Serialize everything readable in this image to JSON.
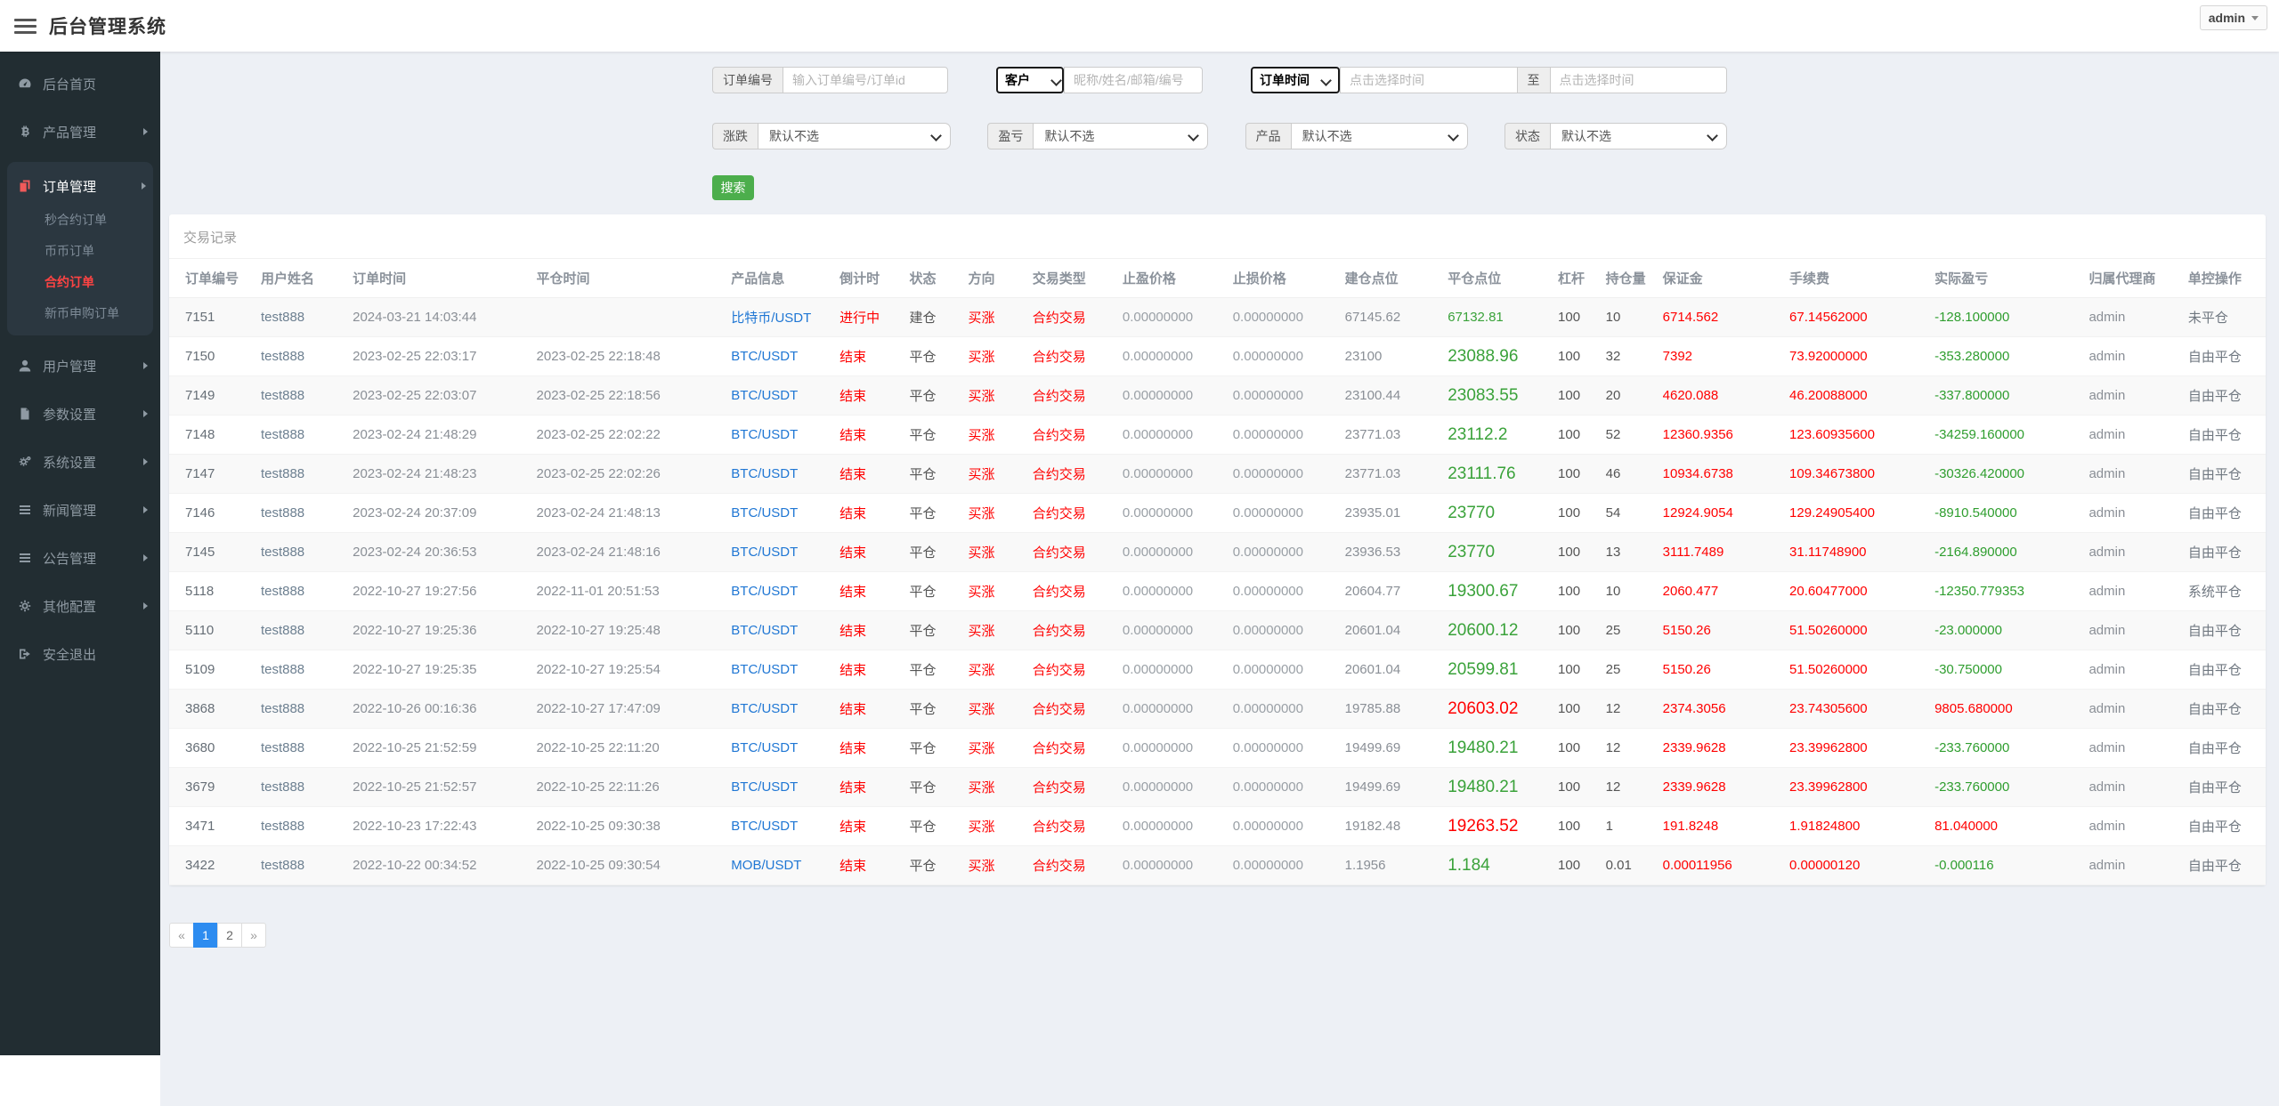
{
  "header": {
    "title": "后台管理系统",
    "user": "admin"
  },
  "colors": {
    "sidebar_bg": "#222d32",
    "main_bg": "#edf0f5",
    "red": "#ff0000",
    "green_close": "#3aa23a",
    "green_pl": "#2f9e2f",
    "link_blue": "#2077d4",
    "search_green": "#4cae4c",
    "active_menu_red": "#ff4343",
    "pagination_blue": "#2d8cf0"
  },
  "sidebar": {
    "items": [
      {
        "key": "home",
        "label": "后台首页",
        "icon": "dashboard-icon",
        "arrow": false
      },
      {
        "key": "products",
        "label": "产品管理",
        "icon": "bitcoin-icon",
        "arrow": true
      },
      {
        "key": "orders",
        "label": "订单管理",
        "icon": "orders-icon",
        "arrow": true,
        "active": true,
        "children": [
          {
            "key": "second-contract",
            "label": "秒合约订单",
            "active": false
          },
          {
            "key": "coin",
            "label": "币币订单",
            "active": false
          },
          {
            "key": "contract",
            "label": "合约订单",
            "active": true
          },
          {
            "key": "new-coin",
            "label": "新币申购订单",
            "active": false
          }
        ]
      },
      {
        "key": "users",
        "label": "用户管理",
        "icon": "user-icon",
        "arrow": true
      },
      {
        "key": "params",
        "label": "参数设置",
        "icon": "file-icon",
        "arrow": true
      },
      {
        "key": "system",
        "label": "系统设置",
        "icon": "gears-icon",
        "arrow": true
      },
      {
        "key": "news",
        "label": "新闻管理",
        "icon": "list-icon",
        "arrow": true
      },
      {
        "key": "notice",
        "label": "公告管理",
        "icon": "list-icon",
        "arrow": true
      },
      {
        "key": "other",
        "label": "其他配置",
        "icon": "gear-icon",
        "arrow": true
      },
      {
        "key": "logout",
        "label": "安全退出",
        "icon": "logout-icon",
        "arrow": false
      }
    ]
  },
  "filters": {
    "order_no": {
      "label": "订单编号",
      "placeholder": "输入订单编号/订单id"
    },
    "customer": {
      "select_value": "客户",
      "placeholder": "昵称/姓名/邮箱/编号"
    },
    "time": {
      "select_value": "订单时间",
      "from_placeholder": "点击选择时间",
      "to_label": "至",
      "to_placeholder": "点击选择时间"
    },
    "rise_fall": {
      "label": "涨跌",
      "value": "默认不选"
    },
    "profit_loss": {
      "label": "盈亏",
      "value": "默认不选"
    },
    "product": {
      "label": "产品",
      "value": "默认不选"
    },
    "status": {
      "label": "状态",
      "value": "默认不选"
    },
    "search_label": "搜索"
  },
  "table": {
    "title": "交易记录",
    "columns": [
      "订单编号",
      "用户姓名",
      "订单时间",
      "平仓时间",
      "产品信息",
      "倒计时",
      "状态",
      "方向",
      "交易类型",
      "止盈价格",
      "止损价格",
      "建仓点位",
      "平仓点位",
      "杠杆",
      "持仓量",
      "保证金",
      "手续费",
      "实际盈亏",
      "归属代理商",
      "单控操作"
    ],
    "rows": [
      {
        "profit": "neg",
        "open": true,
        "cells": [
          "7151",
          "test888",
          "2024-03-21 14:03:44",
          "",
          "比特币/USDT",
          "进行中",
          "建仓",
          "买涨",
          "合约交易",
          "0.00000000",
          "0.00000000",
          "67145.62",
          "67132.81",
          "100",
          "10",
          "6714.562",
          "67.14562000",
          "-128.100000",
          "admin",
          "未平仓"
        ]
      },
      {
        "profit": "neg",
        "cells": [
          "7150",
          "test888",
          "2023-02-25 22:03:17",
          "2023-02-25 22:18:48",
          "BTC/USDT",
          "结束",
          "平仓",
          "买涨",
          "合约交易",
          "0.00000000",
          "0.00000000",
          "23100",
          "23088.96",
          "100",
          "32",
          "7392",
          "73.92000000",
          "-353.280000",
          "admin",
          "自由平仓"
        ]
      },
      {
        "profit": "neg",
        "cells": [
          "7149",
          "test888",
          "2023-02-25 22:03:07",
          "2023-02-25 22:18:56",
          "BTC/USDT",
          "结束",
          "平仓",
          "买涨",
          "合约交易",
          "0.00000000",
          "0.00000000",
          "23100.44",
          "23083.55",
          "100",
          "20",
          "4620.088",
          "46.20088000",
          "-337.800000",
          "admin",
          "自由平仓"
        ]
      },
      {
        "profit": "neg",
        "cells": [
          "7148",
          "test888",
          "2023-02-24 21:48:29",
          "2023-02-25 22:02:22",
          "BTC/USDT",
          "结束",
          "平仓",
          "买涨",
          "合约交易",
          "0.00000000",
          "0.00000000",
          "23771.03",
          "23112.2",
          "100",
          "52",
          "12360.9356",
          "123.60935600",
          "-34259.160000",
          "admin",
          "自由平仓"
        ]
      },
      {
        "profit": "neg",
        "cells": [
          "7147",
          "test888",
          "2023-02-24 21:48:23",
          "2023-02-25 22:02:26",
          "BTC/USDT",
          "结束",
          "平仓",
          "买涨",
          "合约交易",
          "0.00000000",
          "0.00000000",
          "23771.03",
          "23111.76",
          "100",
          "46",
          "10934.6738",
          "109.34673800",
          "-30326.420000",
          "admin",
          "自由平仓"
        ]
      },
      {
        "profit": "neg",
        "cells": [
          "7146",
          "test888",
          "2023-02-24 20:37:09",
          "2023-02-24 21:48:13",
          "BTC/USDT",
          "结束",
          "平仓",
          "买涨",
          "合约交易",
          "0.00000000",
          "0.00000000",
          "23935.01",
          "23770",
          "100",
          "54",
          "12924.9054",
          "129.24905400",
          "-8910.540000",
          "admin",
          "自由平仓"
        ]
      },
      {
        "profit": "neg",
        "cells": [
          "7145",
          "test888",
          "2023-02-24 20:36:53",
          "2023-02-24 21:48:16",
          "BTC/USDT",
          "结束",
          "平仓",
          "买涨",
          "合约交易",
          "0.00000000",
          "0.00000000",
          "23936.53",
          "23770",
          "100",
          "13",
          "3111.7489",
          "31.11748900",
          "-2164.890000",
          "admin",
          "自由平仓"
        ]
      },
      {
        "profit": "neg",
        "cells": [
          "5118",
          "test888",
          "2022-10-27 19:27:56",
          "2022-11-01 20:51:53",
          "BTC/USDT",
          "结束",
          "平仓",
          "买涨",
          "合约交易",
          "0.00000000",
          "0.00000000",
          "20604.77",
          "19300.67",
          "100",
          "10",
          "2060.477",
          "20.60477000",
          "-12350.779353",
          "admin",
          "系统平仓"
        ]
      },
      {
        "profit": "neg",
        "cells": [
          "5110",
          "test888",
          "2022-10-27 19:25:36",
          "2022-10-27 19:25:48",
          "BTC/USDT",
          "结束",
          "平仓",
          "买涨",
          "合约交易",
          "0.00000000",
          "0.00000000",
          "20601.04",
          "20600.12",
          "100",
          "25",
          "5150.26",
          "51.50260000",
          "-23.000000",
          "admin",
          "自由平仓"
        ]
      },
      {
        "profit": "neg",
        "cells": [
          "5109",
          "test888",
          "2022-10-27 19:25:35",
          "2022-10-27 19:25:54",
          "BTC/USDT",
          "结束",
          "平仓",
          "买涨",
          "合约交易",
          "0.00000000",
          "0.00000000",
          "20601.04",
          "20599.81",
          "100",
          "25",
          "5150.26",
          "51.50260000",
          "-30.750000",
          "admin",
          "自由平仓"
        ]
      },
      {
        "profit": "pos",
        "cells": [
          "3868",
          "test888",
          "2022-10-26 00:16:36",
          "2022-10-27 17:47:09",
          "BTC/USDT",
          "结束",
          "平仓",
          "买涨",
          "合约交易",
          "0.00000000",
          "0.00000000",
          "19785.88",
          "20603.02",
          "100",
          "12",
          "2374.3056",
          "23.74305600",
          "9805.680000",
          "admin",
          "自由平仓"
        ]
      },
      {
        "profit": "neg",
        "cells": [
          "3680",
          "test888",
          "2022-10-25 21:52:59",
          "2022-10-25 22:11:20",
          "BTC/USDT",
          "结束",
          "平仓",
          "买涨",
          "合约交易",
          "0.00000000",
          "0.00000000",
          "19499.69",
          "19480.21",
          "100",
          "12",
          "2339.9628",
          "23.39962800",
          "-233.760000",
          "admin",
          "自由平仓"
        ]
      },
      {
        "profit": "neg",
        "cells": [
          "3679",
          "test888",
          "2022-10-25 21:52:57",
          "2022-10-25 22:11:26",
          "BTC/USDT",
          "结束",
          "平仓",
          "买涨",
          "合约交易",
          "0.00000000",
          "0.00000000",
          "19499.69",
          "19480.21",
          "100",
          "12",
          "2339.9628",
          "23.39962800",
          "-233.760000",
          "admin",
          "自由平仓"
        ]
      },
      {
        "profit": "pos",
        "cells": [
          "3471",
          "test888",
          "2022-10-23 17:22:43",
          "2022-10-25 09:30:38",
          "BTC/USDT",
          "结束",
          "平仓",
          "买涨",
          "合约交易",
          "0.00000000",
          "0.00000000",
          "19182.48",
          "19263.52",
          "100",
          "1",
          "191.8248",
          "1.91824800",
          "81.040000",
          "admin",
          "自由平仓"
        ]
      },
      {
        "profit": "neg",
        "cells": [
          "3422",
          "test888",
          "2022-10-22 00:34:52",
          "2022-10-25 09:30:54",
          "MOB/USDT",
          "结束",
          "平仓",
          "买涨",
          "合约交易",
          "0.00000000",
          "0.00000000",
          "1.1956",
          "1.184",
          "100",
          "0.01",
          "0.00011956",
          "0.00000120",
          "-0.000116",
          "admin",
          "自由平仓"
        ]
      }
    ]
  },
  "pagination": {
    "prev": "«",
    "next": "»",
    "pages": [
      {
        "label": "1",
        "active": true
      },
      {
        "label": "2",
        "active": false
      }
    ]
  }
}
